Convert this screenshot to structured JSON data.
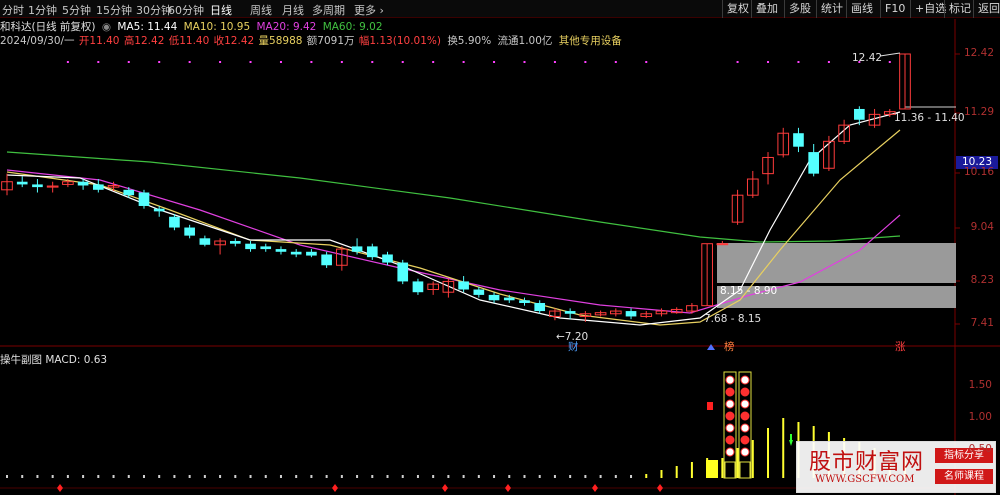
{
  "toolbar": {
    "tabs": [
      "分时",
      "1分钟",
      "5分钟",
      "15分钟",
      "30分钟",
      "60分钟",
      "日线",
      "周线",
      "月线",
      "多周期",
      "更多"
    ],
    "active_tab": "日线",
    "right_buttons": [
      "复权",
      "叠加",
      "多股",
      "统计",
      "画线",
      "F10",
      "+自选",
      "标记",
      "返回"
    ]
  },
  "stock": {
    "name_period": "和科达(日线 前复权)",
    "ma5": "MA5: 11.44",
    "ma10": "MA10: 10.95",
    "ma20": "MA20: 9.42",
    "ma60": "MA60: 9.02"
  },
  "quote": {
    "date": "2024/09/30/一",
    "open": "开11.40",
    "high": "高12.42",
    "low": "低11.40",
    "close": "收12.42",
    "volume": "量58988",
    "amount": "额7091万",
    "change": "幅1.13(10.01%)",
    "turnover": "换5.90%",
    "float": "流通1.00亿",
    "sector": "其他专用设备"
  },
  "price_axis": [
    "12.42",
    "11.29",
    "10.16",
    "9.04",
    "8.23",
    "7.41"
  ],
  "current_price": "10.23",
  "annotations": {
    "high_label": "12.42",
    "range_top": "11.36 - 11.40",
    "range_mid": "8.15 - 8.90",
    "range_low": "7.68 - 8.15",
    "low_label": "7.20",
    "tag_cai": "财",
    "tag_bang": "榜",
    "tag_zhang": "涨"
  },
  "sub_chart": {
    "title": "操牛副图",
    "macd": "MACD: 0.63",
    "axis": [
      "1.50",
      "1.00",
      "0.50"
    ]
  },
  "watermark": {
    "main": "股市财富网",
    "url": "WWW.GSCFW.COM",
    "tag1": "指标分享",
    "tag2": "名师课程"
  },
  "colors": {
    "up": "#ff3c3c",
    "down": "#54ffff",
    "ma5": "#ffffff",
    "ma10": "#e8d060",
    "ma20": "#e040e0",
    "ma60": "#40c040",
    "axis": "#b03030"
  },
  "chart_data": {
    "type": "candlestick",
    "candles": [
      [
        9.9,
        10.05,
        10.2,
        9.8
      ],
      [
        10.05,
        10.0,
        10.15,
        9.95
      ],
      [
        10.0,
        9.95,
        10.1,
        9.85
      ],
      [
        9.95,
        9.97,
        10.05,
        9.85
      ],
      [
        10.0,
        10.05,
        10.1,
        9.95
      ],
      [
        10.05,
        9.98,
        10.1,
        9.9
      ],
      [
        10.0,
        9.9,
        10.1,
        9.85
      ],
      [
        9.95,
        9.98,
        10.05,
        9.88
      ],
      [
        9.9,
        9.8,
        9.95,
        9.75
      ],
      [
        9.85,
        9.6,
        9.9,
        9.55
      ],
      [
        9.55,
        9.5,
        9.6,
        9.4
      ],
      [
        9.4,
        9.2,
        9.45,
        9.15
      ],
      [
        9.2,
        9.05,
        9.25,
        9.0
      ],
      [
        9.0,
        8.88,
        9.05,
        8.85
      ],
      [
        8.88,
        8.95,
        9.0,
        8.7
      ],
      [
        8.95,
        8.9,
        9.0,
        8.85
      ],
      [
        8.9,
        8.8,
        8.95,
        8.75
      ],
      [
        8.85,
        8.8,
        8.9,
        8.75
      ],
      [
        8.8,
        8.75,
        8.85,
        8.7
      ],
      [
        8.75,
        8.7,
        8.8,
        8.65
      ],
      [
        8.75,
        8.68,
        8.8,
        8.65
      ],
      [
        8.7,
        8.5,
        8.75,
        8.45
      ],
      [
        8.5,
        8.8,
        8.85,
        8.4
      ],
      [
        8.85,
        8.75,
        9.0,
        8.7
      ],
      [
        8.85,
        8.65,
        8.9,
        8.6
      ],
      [
        8.7,
        8.55,
        8.75,
        8.5
      ],
      [
        8.55,
        8.2,
        8.6,
        8.15
      ],
      [
        8.2,
        8.0,
        8.25,
        7.95
      ],
      [
        8.05,
        8.15,
        8.2,
        7.95
      ],
      [
        8.0,
        8.2,
        8.25,
        7.9
      ],
      [
        8.2,
        8.05,
        8.3,
        8.0
      ],
      [
        8.05,
        7.95,
        8.1,
        7.9
      ],
      [
        7.95,
        7.85,
        8.0,
        7.8
      ],
      [
        7.9,
        7.85,
        7.95,
        7.8
      ],
      [
        7.85,
        7.8,
        7.9,
        7.75
      ],
      [
        7.8,
        7.65,
        7.85,
        7.6
      ],
      [
        7.55,
        7.65,
        7.7,
        7.48
      ],
      [
        7.65,
        7.6,
        7.7,
        7.5
      ],
      [
        7.55,
        7.6,
        7.65,
        7.45
      ],
      [
        7.58,
        7.62,
        7.66,
        7.55
      ],
      [
        7.6,
        7.65,
        7.7,
        7.55
      ],
      [
        7.65,
        7.55,
        7.7,
        7.5
      ],
      [
        7.55,
        7.6,
        7.65,
        7.52
      ],
      [
        7.6,
        7.65,
        7.7,
        7.55
      ],
      [
        7.62,
        7.68,
        7.72,
        7.6
      ],
      [
        7.65,
        7.75,
        7.8,
        7.6
      ],
      [
        7.75,
        8.9,
        8.9,
        7.75
      ],
      [
        8.9,
        8.9,
        8.95,
        8.9
      ],
      [
        9.3,
        9.8,
        9.9,
        9.25
      ],
      [
        9.8,
        10.1,
        10.25,
        9.75
      ],
      [
        10.2,
        10.5,
        10.6,
        10.0
      ],
      [
        10.55,
        10.95,
        11.05,
        10.5
      ],
      [
        10.95,
        10.7,
        11.05,
        10.6
      ],
      [
        10.6,
        10.2,
        10.75,
        10.15
      ],
      [
        10.3,
        10.8,
        10.9,
        10.25
      ],
      [
        10.8,
        11.1,
        11.2,
        10.75
      ],
      [
        11.4,
        11.2,
        11.45,
        11.1
      ],
      [
        11.1,
        11.3,
        11.4,
        11.05
      ],
      [
        11.3,
        11.35,
        11.4,
        11.25
      ],
      [
        11.4,
        12.42,
        12.42,
        11.4
      ]
    ]
  }
}
